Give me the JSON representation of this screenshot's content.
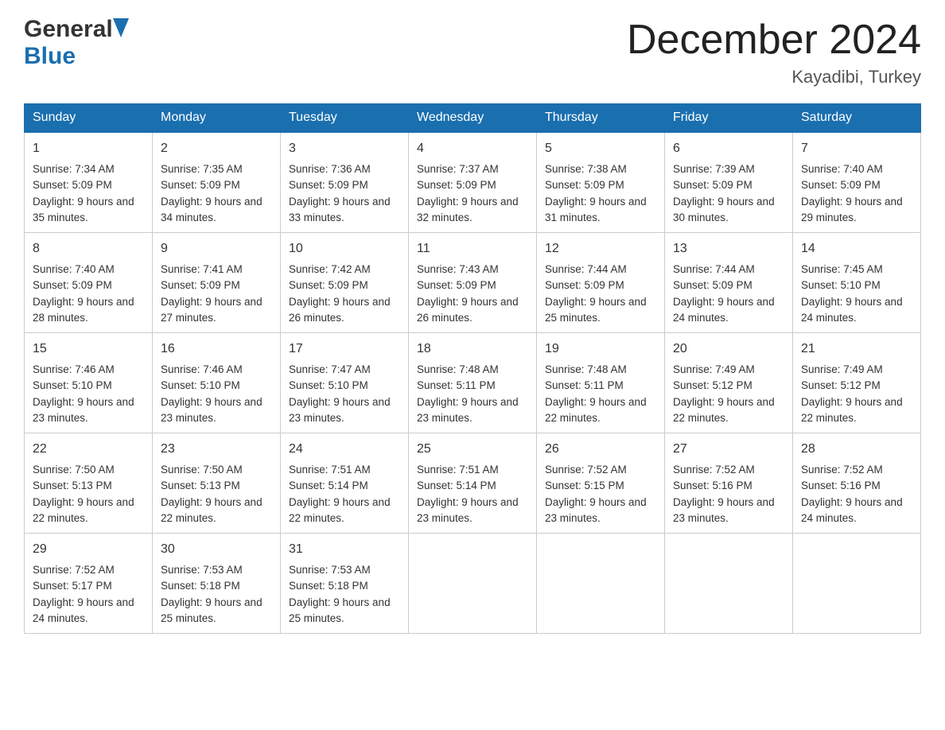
{
  "header": {
    "logo_general": "General",
    "logo_blue": "Blue",
    "month_title": "December 2024",
    "location": "Kayadibi, Turkey"
  },
  "days_of_week": [
    "Sunday",
    "Monday",
    "Tuesday",
    "Wednesday",
    "Thursday",
    "Friday",
    "Saturday"
  ],
  "weeks": [
    [
      {
        "day": "1",
        "sunrise": "7:34 AM",
        "sunset": "5:09 PM",
        "daylight": "9 hours and 35 minutes."
      },
      {
        "day": "2",
        "sunrise": "7:35 AM",
        "sunset": "5:09 PM",
        "daylight": "9 hours and 34 minutes."
      },
      {
        "day": "3",
        "sunrise": "7:36 AM",
        "sunset": "5:09 PM",
        "daylight": "9 hours and 33 minutes."
      },
      {
        "day": "4",
        "sunrise": "7:37 AM",
        "sunset": "5:09 PM",
        "daylight": "9 hours and 32 minutes."
      },
      {
        "day": "5",
        "sunrise": "7:38 AM",
        "sunset": "5:09 PM",
        "daylight": "9 hours and 31 minutes."
      },
      {
        "day": "6",
        "sunrise": "7:39 AM",
        "sunset": "5:09 PM",
        "daylight": "9 hours and 30 minutes."
      },
      {
        "day": "7",
        "sunrise": "7:40 AM",
        "sunset": "5:09 PM",
        "daylight": "9 hours and 29 minutes."
      }
    ],
    [
      {
        "day": "8",
        "sunrise": "7:40 AM",
        "sunset": "5:09 PM",
        "daylight": "9 hours and 28 minutes."
      },
      {
        "day": "9",
        "sunrise": "7:41 AM",
        "sunset": "5:09 PM",
        "daylight": "9 hours and 27 minutes."
      },
      {
        "day": "10",
        "sunrise": "7:42 AM",
        "sunset": "5:09 PM",
        "daylight": "9 hours and 26 minutes."
      },
      {
        "day": "11",
        "sunrise": "7:43 AM",
        "sunset": "5:09 PM",
        "daylight": "9 hours and 26 minutes."
      },
      {
        "day": "12",
        "sunrise": "7:44 AM",
        "sunset": "5:09 PM",
        "daylight": "9 hours and 25 minutes."
      },
      {
        "day": "13",
        "sunrise": "7:44 AM",
        "sunset": "5:09 PM",
        "daylight": "9 hours and 24 minutes."
      },
      {
        "day": "14",
        "sunrise": "7:45 AM",
        "sunset": "5:10 PM",
        "daylight": "9 hours and 24 minutes."
      }
    ],
    [
      {
        "day": "15",
        "sunrise": "7:46 AM",
        "sunset": "5:10 PM",
        "daylight": "9 hours and 23 minutes."
      },
      {
        "day": "16",
        "sunrise": "7:46 AM",
        "sunset": "5:10 PM",
        "daylight": "9 hours and 23 minutes."
      },
      {
        "day": "17",
        "sunrise": "7:47 AM",
        "sunset": "5:10 PM",
        "daylight": "9 hours and 23 minutes."
      },
      {
        "day": "18",
        "sunrise": "7:48 AM",
        "sunset": "5:11 PM",
        "daylight": "9 hours and 23 minutes."
      },
      {
        "day": "19",
        "sunrise": "7:48 AM",
        "sunset": "5:11 PM",
        "daylight": "9 hours and 22 minutes."
      },
      {
        "day": "20",
        "sunrise": "7:49 AM",
        "sunset": "5:12 PM",
        "daylight": "9 hours and 22 minutes."
      },
      {
        "day": "21",
        "sunrise": "7:49 AM",
        "sunset": "5:12 PM",
        "daylight": "9 hours and 22 minutes."
      }
    ],
    [
      {
        "day": "22",
        "sunrise": "7:50 AM",
        "sunset": "5:13 PM",
        "daylight": "9 hours and 22 minutes."
      },
      {
        "day": "23",
        "sunrise": "7:50 AM",
        "sunset": "5:13 PM",
        "daylight": "9 hours and 22 minutes."
      },
      {
        "day": "24",
        "sunrise": "7:51 AM",
        "sunset": "5:14 PM",
        "daylight": "9 hours and 22 minutes."
      },
      {
        "day": "25",
        "sunrise": "7:51 AM",
        "sunset": "5:14 PM",
        "daylight": "9 hours and 23 minutes."
      },
      {
        "day": "26",
        "sunrise": "7:52 AM",
        "sunset": "5:15 PM",
        "daylight": "9 hours and 23 minutes."
      },
      {
        "day": "27",
        "sunrise": "7:52 AM",
        "sunset": "5:16 PM",
        "daylight": "9 hours and 23 minutes."
      },
      {
        "day": "28",
        "sunrise": "7:52 AM",
        "sunset": "5:16 PM",
        "daylight": "9 hours and 24 minutes."
      }
    ],
    [
      {
        "day": "29",
        "sunrise": "7:52 AM",
        "sunset": "5:17 PM",
        "daylight": "9 hours and 24 minutes."
      },
      {
        "day": "30",
        "sunrise": "7:53 AM",
        "sunset": "5:18 PM",
        "daylight": "9 hours and 25 minutes."
      },
      {
        "day": "31",
        "sunrise": "7:53 AM",
        "sunset": "5:18 PM",
        "daylight": "9 hours and 25 minutes."
      },
      null,
      null,
      null,
      null
    ]
  ],
  "labels": {
    "sunrise": "Sunrise:",
    "sunset": "Sunset:",
    "daylight": "Daylight:"
  }
}
